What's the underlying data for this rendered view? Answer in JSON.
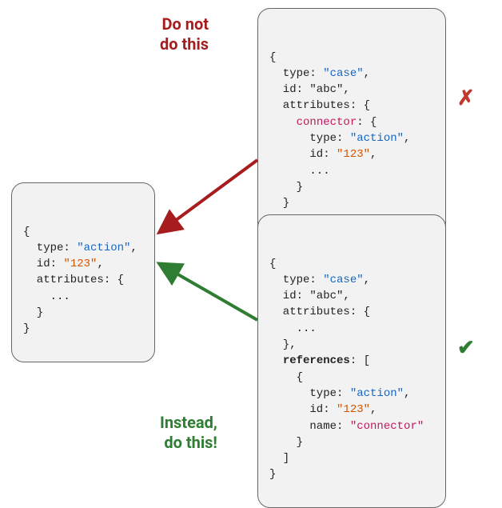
{
  "labels": {
    "bad": "Do not\ndo this",
    "good": "Instead,\ndo this!"
  },
  "marks": {
    "bad": "✗",
    "good": "✔"
  },
  "colors": {
    "bad": "#a71d1d",
    "good": "#2e7d32",
    "box_bg": "#f2f2f2",
    "box_border": "#666666"
  },
  "target_box": {
    "lines": [
      {
        "segments": [
          {
            "t": "{"
          }
        ]
      },
      {
        "segments": [
          {
            "t": "  type: "
          },
          {
            "t": "\"action\"",
            "c": "str-blue"
          },
          {
            "t": ","
          }
        ]
      },
      {
        "segments": [
          {
            "t": "  id: "
          },
          {
            "t": "\"123\"",
            "c": "str-orange"
          },
          {
            "t": ","
          }
        ]
      },
      {
        "segments": [
          {
            "t": "  attributes: {"
          }
        ]
      },
      {
        "segments": [
          {
            "t": "    ..."
          }
        ]
      },
      {
        "segments": [
          {
            "t": "  }"
          }
        ]
      },
      {
        "segments": [
          {
            "t": "}"
          }
        ]
      }
    ]
  },
  "bad_box": {
    "lines": [
      {
        "segments": [
          {
            "t": "{"
          }
        ]
      },
      {
        "segments": [
          {
            "t": "  type: "
          },
          {
            "t": "\"case\"",
            "c": "str-blue"
          },
          {
            "t": ","
          }
        ]
      },
      {
        "segments": [
          {
            "t": "  id: \"abc\","
          }
        ]
      },
      {
        "segments": [
          {
            "t": "  attributes: {"
          }
        ]
      },
      {
        "segments": [
          {
            "t": "    "
          },
          {
            "t": "connector",
            "c": "str-pink"
          },
          {
            "t": ": {"
          }
        ]
      },
      {
        "segments": [
          {
            "t": "      type: "
          },
          {
            "t": "\"action\"",
            "c": "str-blue"
          },
          {
            "t": ","
          }
        ]
      },
      {
        "segments": [
          {
            "t": "      id: "
          },
          {
            "t": "\"123\"",
            "c": "str-orange"
          },
          {
            "t": ","
          }
        ]
      },
      {
        "segments": [
          {
            "t": "      ..."
          }
        ]
      },
      {
        "segments": [
          {
            "t": "    }"
          }
        ]
      },
      {
        "segments": [
          {
            "t": "  }"
          }
        ]
      },
      {
        "segments": [
          {
            "t": "}"
          }
        ]
      }
    ]
  },
  "good_box": {
    "lines": [
      {
        "segments": [
          {
            "t": "{"
          }
        ]
      },
      {
        "segments": [
          {
            "t": "  type: "
          },
          {
            "t": "\"case\"",
            "c": "str-blue"
          },
          {
            "t": ","
          }
        ]
      },
      {
        "segments": [
          {
            "t": "  id: \"abc\","
          }
        ]
      },
      {
        "segments": [
          {
            "t": "  attributes: {"
          }
        ]
      },
      {
        "segments": [
          {
            "t": "    ..."
          }
        ]
      },
      {
        "segments": [
          {
            "t": "  },"
          }
        ]
      },
      {
        "segments": [
          {
            "t": "  "
          },
          {
            "t": "references",
            "c": "bold"
          },
          {
            "t": ": ["
          }
        ]
      },
      {
        "segments": [
          {
            "t": "    {"
          }
        ]
      },
      {
        "segments": [
          {
            "t": "      type: "
          },
          {
            "t": "\"action\"",
            "c": "str-blue"
          },
          {
            "t": ","
          }
        ]
      },
      {
        "segments": [
          {
            "t": "      id: "
          },
          {
            "t": "\"123\"",
            "c": "str-orange"
          },
          {
            "t": ","
          }
        ]
      },
      {
        "segments": [
          {
            "t": "      name: "
          },
          {
            "t": "\"connector\"",
            "c": "str-pink"
          }
        ]
      },
      {
        "segments": [
          {
            "t": "    }"
          }
        ]
      },
      {
        "segments": [
          {
            "t": "  ]"
          }
        ]
      },
      {
        "segments": [
          {
            "t": "}"
          }
        ]
      }
    ]
  }
}
